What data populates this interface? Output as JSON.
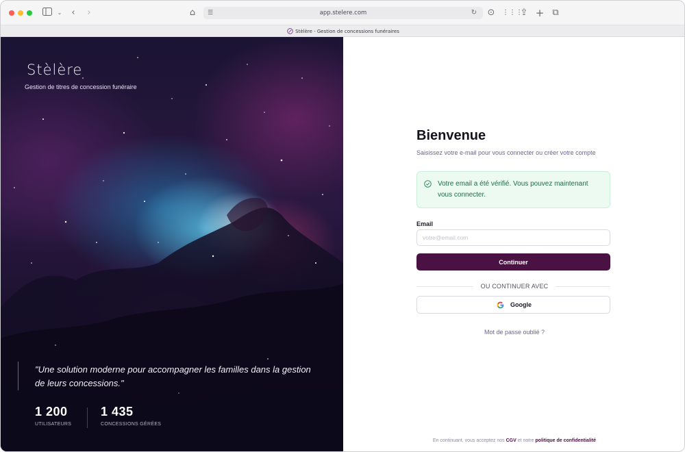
{
  "browser": {
    "url": "app.stelere.com",
    "tab_title": "Stèlère - Gestion de concessions funéraires"
  },
  "hero": {
    "brand": "Stèlère",
    "tagline": "Gestion de titres de concession funéraire",
    "quote": "\"Une solution moderne pour accompagner les familles dans la gestion de leurs concessions.\"",
    "stats": [
      {
        "value": "1 200",
        "label": "UTILISATEURS"
      },
      {
        "value": "1 435",
        "label": "CONCESSIONS GÉRÉES"
      }
    ]
  },
  "login": {
    "title": "Bienvenue",
    "subtitle": "Saisissez votre e-mail pour vous connecter ou créer votre compte",
    "alert_message": "Votre email a été vérifié. Vous pouvez maintenant vous connecter.",
    "email_label": "Email",
    "email_value": "",
    "email_placeholder": "votre@email.com",
    "continue_label": "Continuer",
    "divider_label": "OU CONTINUER AVEC",
    "google_label": "Google",
    "forgot_label": "Mot de passe oublié ?"
  },
  "terms": {
    "prefix": "En continuant, vous acceptez nos",
    "cgv": "CGV",
    "middle": "et notre",
    "privacy": "politique de confidentialité"
  },
  "colors": {
    "accent": "#4a1143",
    "success_bg": "#ecfaf2",
    "success_text": "#1f6b43"
  }
}
